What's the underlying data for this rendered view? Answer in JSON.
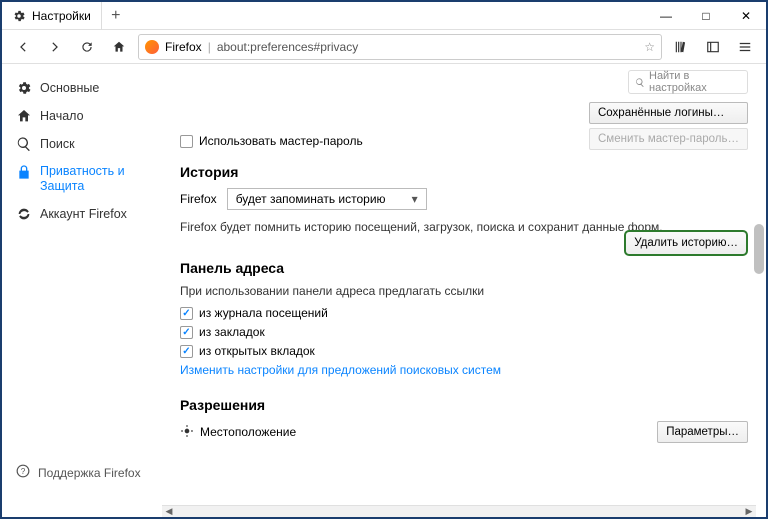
{
  "tab": {
    "title": "Настройки"
  },
  "url": {
    "prefix": "Firefox",
    "path": "about:preferences#privacy"
  },
  "search": {
    "placeholder": "Найти в настройках"
  },
  "sidebar": {
    "items": [
      {
        "label": "Основные"
      },
      {
        "label": "Начало"
      },
      {
        "label": "Поиск"
      },
      {
        "label": "Приватность и Защита"
      },
      {
        "label": "Аккаунт Firefox"
      }
    ],
    "support": "Поддержка Firefox"
  },
  "buttons": {
    "saved_logins": "Сохранённые логины…",
    "change_master": "Сменить мастер-пароль…",
    "delete_history": "Удалить историю…",
    "params": "Параметры…"
  },
  "master_pw": {
    "label": "Использовать мастер-пароль"
  },
  "history": {
    "heading": "История",
    "label": "Firefox",
    "select": "будет запоминать историю",
    "desc": "Firefox будет помнить историю посещений, загрузок, поиска и сохранит данные форм."
  },
  "addressbar": {
    "heading": "Панель адреса",
    "desc": "При использовании панели адреса предлагать ссылки",
    "opts": [
      "из журнала посещений",
      "из закладок",
      "из открытых вкладок"
    ],
    "link": "Изменить настройки для предложений поисковых систем"
  },
  "permissions": {
    "heading": "Разрешения",
    "location": "Местоположение"
  }
}
